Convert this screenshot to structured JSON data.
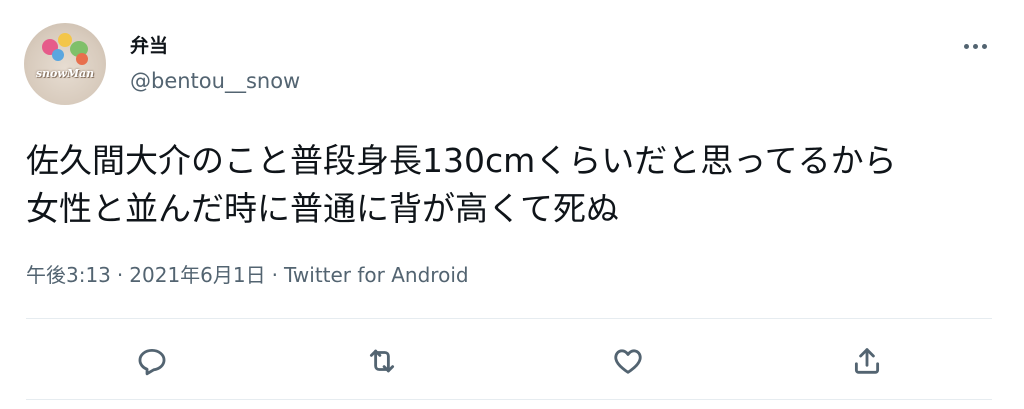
{
  "tweet": {
    "display_name": "弁当",
    "handle": "@bentou__snow",
    "avatar_logo_text": "snowMan",
    "text": "佐久間大介のこと普段身長130cmくらいだと思ってるから\n女性と並んだ時に普通に背が高くて死ぬ",
    "time": "午後3:13",
    "separator": "·",
    "date": "2021年6月1日",
    "source": "Twitter for Android"
  },
  "actions": {
    "reply_icon": "reply-icon",
    "retweet_icon": "retweet-icon",
    "like_icon": "heart-icon",
    "share_icon": "share-icon",
    "more_icon": "more-icon"
  },
  "colors": {
    "text_primary": "#0f1419",
    "text_secondary": "#536471",
    "divider": "#e6ecf0"
  }
}
